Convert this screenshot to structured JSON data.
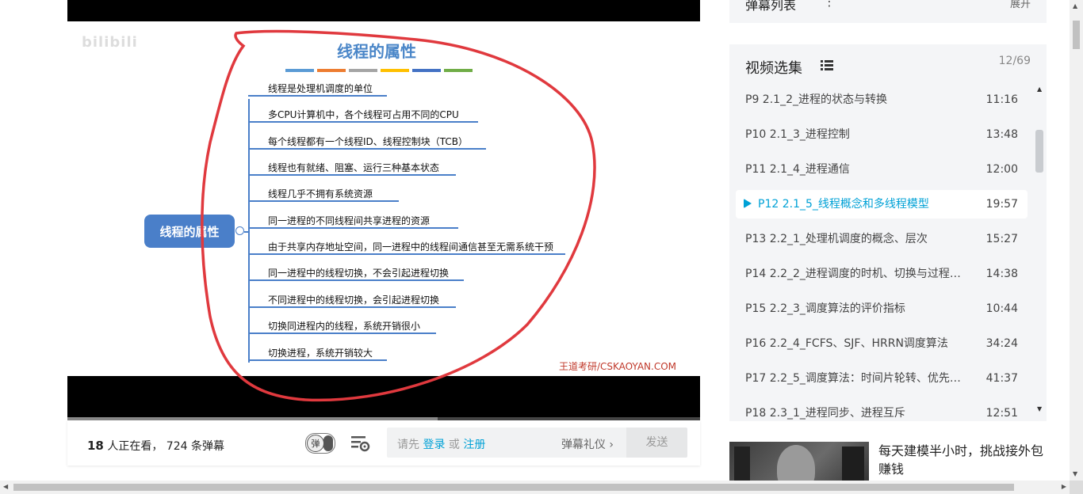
{
  "slide": {
    "watermark": "bilibili",
    "title": "线程的属性",
    "root": "线程的属性",
    "colors": [
      "#5b9bd5",
      "#ed7d31",
      "#a5a5a5",
      "#ffc000",
      "#4472c4",
      "#70ad47"
    ],
    "branches": [
      "线程是处理机调度的单位",
      "多CPU计算机中，各个线程可占用不同的CPU",
      "每个线程都有一个线程ID、线程控制块（TCB）",
      "线程也有就绪、阻塞、运行三种基本状态",
      "线程几乎不拥有系统资源",
      "同一进程的不同线程间共享进程的资源",
      "由于共享内存地址空间，同一进程中的线程间通信甚至无需系统干预",
      "同一进程中的线程切换，不会引起进程切换",
      "不同进程中的线程切换，会引起进程切换",
      "切换同进程内的线程，系统开销很小",
      "切换进程，系统开销较大"
    ],
    "brand": "王道考研/CSKAOYAN.COM"
  },
  "player": {
    "progress": 0.535,
    "buffered": 0.585
  },
  "controls": {
    "viewer_count": "18",
    "viewer_suffix": " 人正在看，",
    "danmaku_count": "724 条弹幕",
    "toggle_label": "弹",
    "input_prefix": "请先 ",
    "login": "登录",
    "or": " 或 ",
    "register": "注册",
    "etiquette": "弹幕礼仪 ›",
    "send": "发送"
  },
  "sidebar": {
    "danmaku_list_title": "弹幕列表",
    "danmaku_list_more": "⋮",
    "danmaku_list_expand": "展开",
    "episodes_title": "视频选集",
    "episodes_count": "12/69",
    "episodes": [
      {
        "label": "P9   2.1_2_进程的状态与转换",
        "duration": "11:16"
      },
      {
        "label": "P10   2.1_3_进程控制",
        "duration": "13:48"
      },
      {
        "label": "P11   2.1_4_进程通信",
        "duration": "12:00"
      },
      {
        "label": "P12   2.1_5_线程概念和多线程模型",
        "duration": "19:57",
        "active": true
      },
      {
        "label": "P13   2.2_1_处理机调度的概念、层次",
        "duration": "15:27"
      },
      {
        "label": "P14   2.2_2_进程调度的时机、切换与过程…",
        "duration": "14:38"
      },
      {
        "label": "P15   2.2_3_调度算法的评价指标",
        "duration": "10:44"
      },
      {
        "label": "P16   2.2_4_FCFS、SJF、HRRN调度算法",
        "duration": "34:24"
      },
      {
        "label": "P17   2.2_5_调度算法：时间片轮转、优先…",
        "duration": "41:37"
      },
      {
        "label": "P18   2.3_1_进程同步、进程互斥",
        "duration": "12:51"
      }
    ],
    "recommend_title": "每天建模半小时，挑战接外包赚钱"
  }
}
